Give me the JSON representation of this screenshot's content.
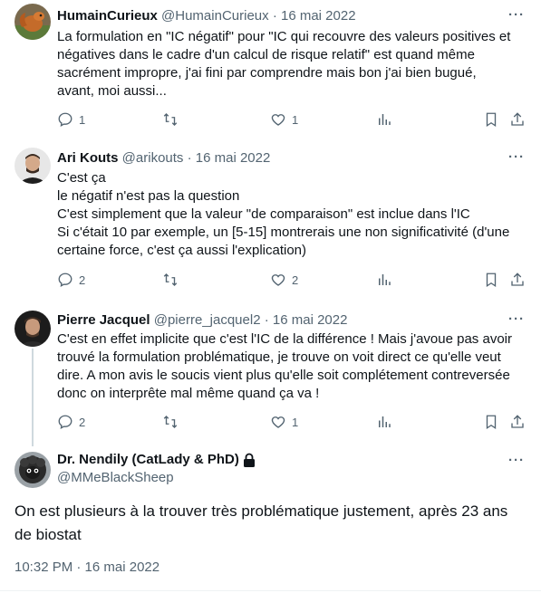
{
  "tweets": [
    {
      "name": "HumainCurieux",
      "handle": "@HumainCurieux",
      "sep": "·",
      "date": "16 mai 2022",
      "lines": [
        "La formulation en \"IC négatif\" pour \"IC qui recouvre des valeurs positives et",
        "négatives dans le cadre d'un calcul de risque relatif\" est quand même",
        "sacrément impropre, j'ai fini par comprendre mais bon j'ai bien bugué,",
        "avant, moi aussi..."
      ],
      "replies": "1",
      "likes": "1"
    },
    {
      "name": "Ari Kouts",
      "handle": "@arikouts",
      "sep": "·",
      "date": "16 mai 2022",
      "lines": [
        "C'est ça",
        "le négatif n'est pas la question",
        "C'est simplement que la valeur \"de comparaison\" est inclue dans l'IC",
        "Si c'était 10 par exemple, un [5-15] montrerais une non significativité (d'une",
        "certaine force, c'est ça aussi l'explication)"
      ],
      "replies": "2",
      "likes": "2"
    },
    {
      "name": "Pierre Jacquel",
      "handle": "@pierre_jacquel2",
      "sep": "·",
      "date": "16 mai 2022",
      "lines": [
        "C'est en effet implicite que c'est l'IC de la différence ! Mais j'avoue pas avoir",
        "trouvé la formulation problématique, je trouve on voit direct ce qu'elle veut",
        "dire. A mon avis le soucis vient plus qu'elle soit complétement contreversée",
        "donc on interprête mal même quand ça va !"
      ],
      "replies": "2",
      "likes": "1"
    }
  ],
  "focus": {
    "name": "Dr. Nendily (CatLady & PhD)",
    "handle": "@MMeBlackSheep",
    "text_line1": "On est plusieurs à la trouver très problématique justement, après 23 ans",
    "text_line2": "de biostat",
    "timestamp": "10:32 PM · 16 mai 2022"
  },
  "more_glyph": "···",
  "colors": {
    "text": "#0f1419",
    "secondary": "#536471",
    "line": "#cfd9de"
  }
}
